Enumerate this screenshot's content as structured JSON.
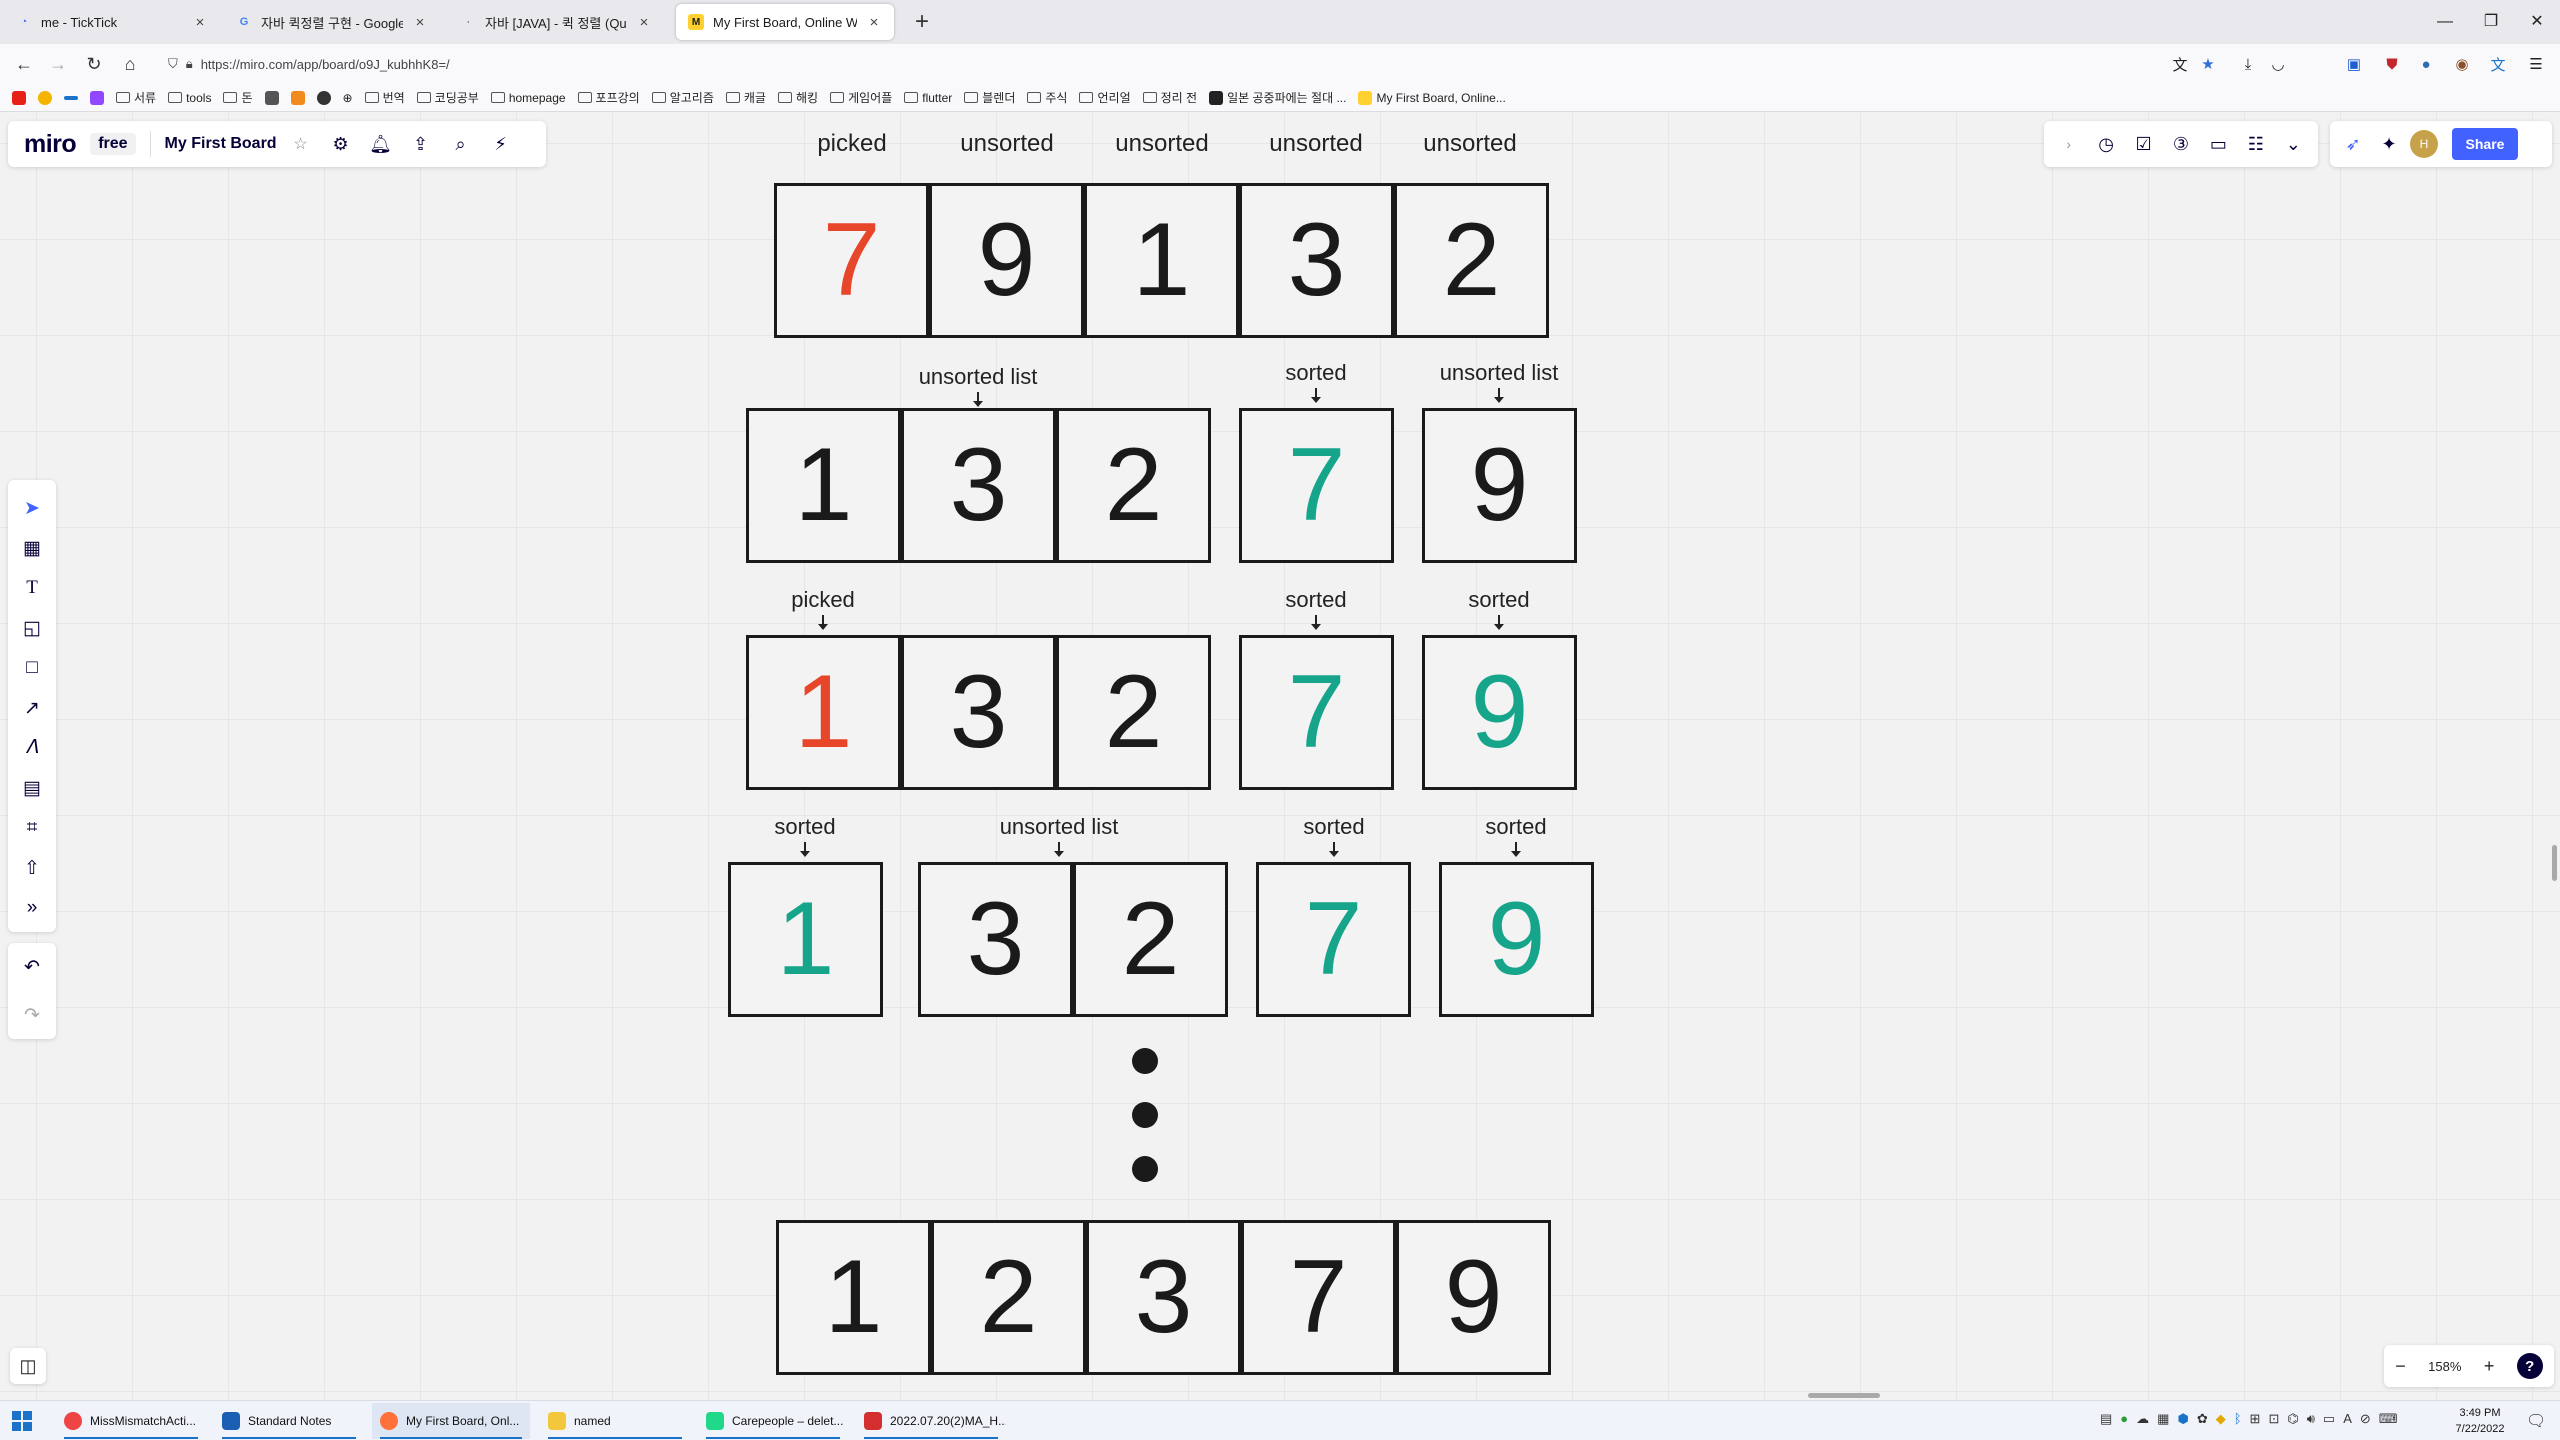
{
  "browser": {
    "tabs": [
      {
        "title": "me - TickTick",
        "active": false
      },
      {
        "title": "자바 퀵정렬 구현 - Google Search",
        "active": false
      },
      {
        "title": "자바 [JAVA] - 퀵 정렬 (Quick Sort)",
        "active": false
      },
      {
        "title": "My First Board, Online Whiteboard",
        "active": true
      }
    ],
    "url": "https://miro.com/app/board/o9J_kubhhK8=/",
    "bookmarks": [
      "서류",
      "tools",
      "돈",
      "번역",
      "코딩공부",
      "homepage",
      "포프강의",
      "알고리즘",
      "캐글",
      "해킹",
      "게임어플",
      "flutter",
      "블렌더",
      "주식",
      "언리얼",
      "정리 전",
      "일본 공중파에는 절대 ...",
      "My First Board, Online..."
    ]
  },
  "miro": {
    "logo": "miro",
    "plan": "free",
    "board_name": "My First Board",
    "share_label": "Share",
    "zoom": "158%",
    "help": "?",
    "avatar_initial": "H"
  },
  "board": {
    "row1": {
      "labels": [
        "picked",
        "unsorted",
        "unsorted",
        "unsorted",
        "unsorted"
      ],
      "cells": [
        {
          "v": "7",
          "c": "red"
        },
        {
          "v": "9",
          "c": "black"
        },
        {
          "v": "1",
          "c": "black"
        },
        {
          "v": "3",
          "c": "black"
        },
        {
          "v": "2",
          "c": "black"
        }
      ]
    },
    "row2": {
      "labels": [
        "unsorted list",
        "sorted",
        "unsorted list"
      ],
      "cells": [
        {
          "v": "1",
          "c": "black"
        },
        {
          "v": "3",
          "c": "black"
        },
        {
          "v": "2",
          "c": "black"
        },
        {
          "v": "7",
          "c": "green"
        },
        {
          "v": "9",
          "c": "black"
        }
      ]
    },
    "row3": {
      "labels": [
        "picked",
        "sorted",
        "sorted"
      ],
      "cells": [
        {
          "v": "1",
          "c": "red"
        },
        {
          "v": "3",
          "c": "black"
        },
        {
          "v": "2",
          "c": "black"
        },
        {
          "v": "7",
          "c": "green"
        },
        {
          "v": "9",
          "c": "green"
        }
      ]
    },
    "row4": {
      "labels": [
        "sorted",
        "unsorted list",
        "sorted",
        "sorted"
      ],
      "cells": [
        {
          "v": "1",
          "c": "green"
        },
        {
          "v": "3",
          "c": "black"
        },
        {
          "v": "2",
          "c": "black"
        },
        {
          "v": "7",
          "c": "green"
        },
        {
          "v": "9",
          "c": "green"
        }
      ]
    },
    "row5": {
      "cells": [
        {
          "v": "1",
          "c": "black"
        },
        {
          "v": "2",
          "c": "black"
        },
        {
          "v": "3",
          "c": "black"
        },
        {
          "v": "7",
          "c": "black"
        },
        {
          "v": "9",
          "c": "black"
        }
      ]
    },
    "colors": {
      "red": "#e8462b",
      "green": "#16a58a",
      "black": "#1a1a1a"
    }
  },
  "taskbar": {
    "items": [
      "MissMismatchActi...",
      "Standard Notes",
      "My First Board, Onl...",
      "named",
      "Carepeople – delet...",
      "2022.07.20(2)MA_H..."
    ],
    "time": "3:49 PM",
    "date": "7/22/2022"
  }
}
